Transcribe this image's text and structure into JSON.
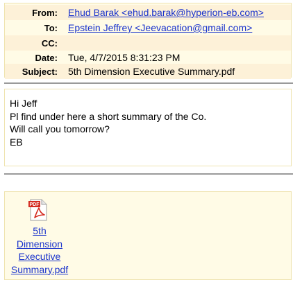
{
  "header": {
    "from_label": "From:",
    "from_value": "Ehud Barak <ehud.barak@hyperion-eb.com>",
    "to_label": "To:",
    "to_value": "Epstein Jeffrey <Jeevacation@gmail.com>",
    "cc_label": "CC:",
    "cc_value": "",
    "date_label": "Date:",
    "date_value": "Tue, 4/7/2015 8:31:23 PM",
    "subject_label": "Subject:",
    "subject_value": "5th Dimension Executive Summary.pdf"
  },
  "message": {
    "lines": [
      "Hi Jeff",
      "Pl find under here a short summary of the Co.",
      "Will call you tomorrow?",
      "EB"
    ]
  },
  "attachment": {
    "icon": "pdf-file-icon",
    "icon_badge": "PDF",
    "name_lines": [
      "5th",
      "Dimension",
      "Executive",
      "Summary.pdf"
    ]
  },
  "colors": {
    "header_bg": "#fffbe6",
    "row_shade": "#fdf1d8",
    "link": "#1a33cc",
    "pdf_red": "#d42a1f"
  }
}
